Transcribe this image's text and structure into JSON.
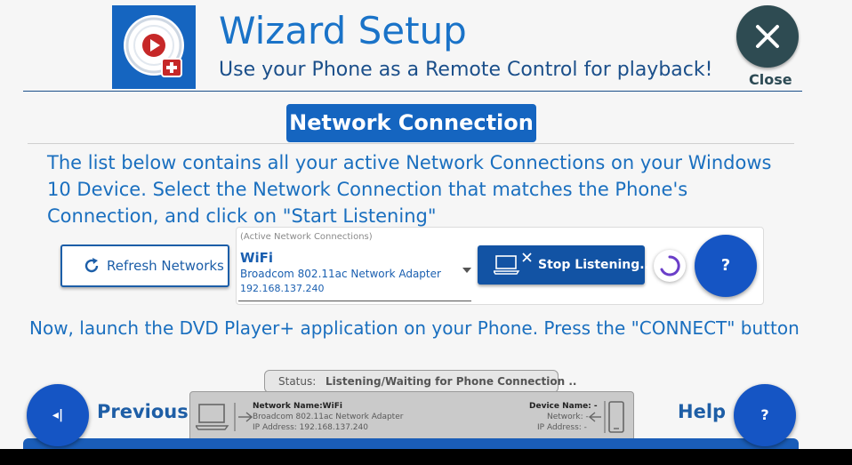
{
  "header": {
    "title": "Wizard Setup",
    "subtitle": "Use your Phone as a Remote Control for playback!",
    "app_icon": "dvd-player-plus-icon",
    "close_label": "Close",
    "close_icon": "close-icon"
  },
  "section": {
    "title": "Network Connection",
    "instructions": "The list below contains all your active Network Connections on your Windows 10 Device. Select the Network Connection that matches the Phone's Connection, and click on \"Start Listening\""
  },
  "controls": {
    "refresh_label": "Refresh Networks",
    "combo": {
      "caption": "(Active Network Connections)",
      "selected_title": "WiFi",
      "selected_adapter": "Broadcom 802.11ac Network Adapter",
      "selected_ip": "192.168.137.240"
    },
    "listen_label": "Stop Listening..",
    "help_label": "?"
  },
  "launch_text": "Now, launch the DVD Player+ application on your Phone. Press the \"CONNECT\" button",
  "status": {
    "key": "Status:",
    "value": "Listening/Waiting for Phone Connection .."
  },
  "connection": {
    "network_name": "Network Name:WiFi",
    "adapter": "Broadcom 802.11ac Network Adapter",
    "ip": "IP Address: 192.168.137.240",
    "device_name": "Device Name: -",
    "device_network": "Network: -",
    "device_ip": "IP Address: -"
  },
  "footer": {
    "previous_label": "Previous",
    "previous_icon_text": "◂|",
    "help_label": "Help",
    "help_icon_text": "?"
  },
  "colors": {
    "accent": "#1565c0",
    "close_bg": "#2e4b52",
    "text_blue": "#1a6fbf"
  }
}
